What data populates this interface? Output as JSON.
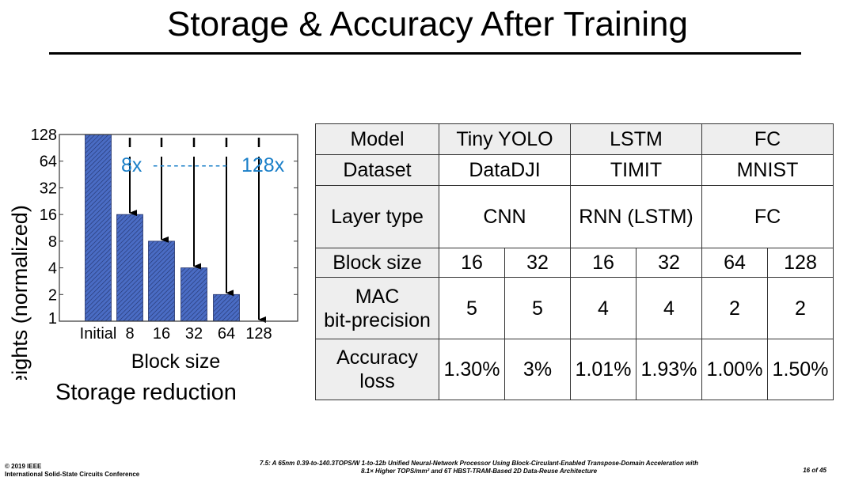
{
  "title": "Storage & Accuracy After Training",
  "caption": "Storage reduction",
  "chart_data": {
    "type": "bar",
    "categories": [
      "Initial",
      "8",
      "16",
      "32",
      "64",
      "128"
    ],
    "values": [
      128,
      16,
      8,
      4,
      2,
      1
    ],
    "xlabel": "Block size",
    "ylabel": "# of weights (normalized)",
    "yscale": "log2",
    "ylim": [
      1,
      128
    ],
    "yticks": [
      1,
      2,
      4,
      8,
      16,
      32,
      64,
      128
    ],
    "bar_color": "#4a6cc4",
    "bar_pattern": "diagonal-hatch",
    "annotations": {
      "left": "8x",
      "dash": "-----------",
      "right": "128x",
      "color": "#1a7fc8"
    }
  },
  "table": {
    "rows": [
      {
        "label": "Model",
        "cells": [
          {
            "t": "Tiny YOLO",
            "span": 2
          },
          {
            "t": "LSTM",
            "span": 2
          },
          {
            "t": "FC",
            "span": 2
          }
        ],
        "header": true
      },
      {
        "label": "Dataset",
        "cells": [
          {
            "t": "DataDJI",
            "span": 2
          },
          {
            "t": "TIMIT",
            "span": 2
          },
          {
            "t": "MNIST",
            "span": 2
          }
        ]
      },
      {
        "label": "Layer type",
        "cells": [
          {
            "t": "CNN",
            "span": 2
          },
          {
            "t": "RNN (LSTM)",
            "span": 2
          },
          {
            "t": "FC",
            "span": 2
          }
        ]
      },
      {
        "label": "Block size",
        "cells": [
          {
            "t": "16"
          },
          {
            "t": "32"
          },
          {
            "t": "16"
          },
          {
            "t": "32"
          },
          {
            "t": "64"
          },
          {
            "t": "128"
          }
        ]
      },
      {
        "label": "MAC\nbit-precision",
        "cells": [
          {
            "t": "5"
          },
          {
            "t": "5"
          },
          {
            "t": "4"
          },
          {
            "t": "4"
          },
          {
            "t": "2"
          },
          {
            "t": "2"
          }
        ]
      },
      {
        "label": "Accuracy\nloss",
        "cells": [
          {
            "t": "1.30%"
          },
          {
            "t": "3%"
          },
          {
            "t": "1.01%"
          },
          {
            "t": "1.93%"
          },
          {
            "t": "1.00%"
          },
          {
            "t": "1.50%"
          }
        ]
      }
    ]
  },
  "footer": {
    "left_line1": "© 2019 IEEE",
    "left_line2": "International Solid-State Circuits Conference",
    "center_line1": "7.5: A 65nm 0.39-to-140.3TOPS/W 1-to-12b Unified Neural-Network Processor Using Block-Circulant-Enabled Transpose-Domain Acceleration with",
    "center_line2": "8.1× Higher TOPS/mm² and 6T HBST-TRAM-Based 2D Data-Reuse Architecture",
    "page": "16 of 45"
  }
}
